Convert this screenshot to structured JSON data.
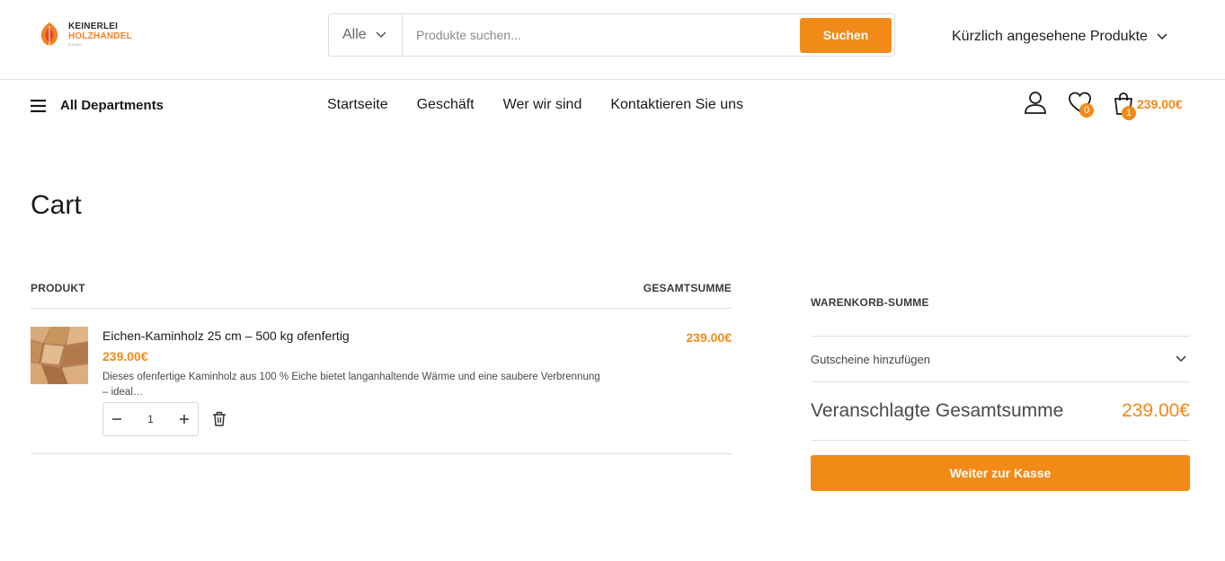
{
  "brand": {
    "line1": "KEINERLEI",
    "line2": "HOLZHANDEL",
    "line3": "GMBH",
    "accent_color": "#f28a18"
  },
  "search": {
    "category": "Alle",
    "placeholder": "Produkte suchen...",
    "button_label": "Suchen"
  },
  "recent": {
    "label": "Kürzlich angesehene Produkte"
  },
  "nav": {
    "departments_label": "All Departments",
    "links": [
      "Startseite",
      "Geschäft",
      "Wer wir sind",
      "Kontaktieren Sie uns"
    ],
    "wishlist_count": "0",
    "cart_count": "1",
    "cart_total": "239.00€"
  },
  "page": {
    "title": "Cart"
  },
  "cart": {
    "col_product": "PRODUKT",
    "col_total": "GESAMTSUMME",
    "items": [
      {
        "name": "Eichen-Kaminholz 25 cm – 500 kg ofenfertig",
        "price": "239.00€",
        "description": "Dieses ofenfertige Kaminholz aus 100 % Eiche bietet langanhaltende Wärme und eine saubere Verbrennung – ideal…",
        "quantity": "1",
        "subtotal": "239.00€"
      }
    ]
  },
  "summary": {
    "title": "WARENKORB-SUMME",
    "coupon_label": "Gutscheine hinzufügen",
    "estimate_label": "Veranschlagte Gesamtsumme",
    "estimate_value": "239.00€",
    "checkout_label": "Weiter zur Kasse"
  }
}
